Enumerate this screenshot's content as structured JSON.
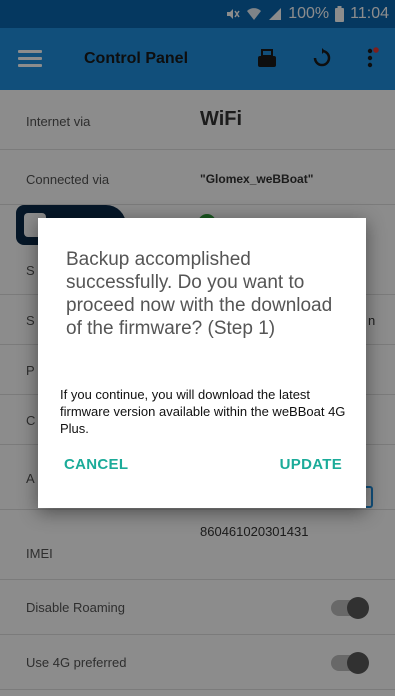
{
  "status_bar": {
    "icons": [
      "mute-icon",
      "wifi-icon",
      "signal-icon"
    ],
    "battery": "100%",
    "time": "11:04"
  },
  "toolbar": {
    "title": "Control Panel",
    "icons": [
      "menu-icon",
      "router-icon",
      "refresh-icon",
      "overflow-menu-icon"
    ]
  },
  "rows": {
    "internet_via": {
      "label": "Internet via",
      "value": "WiFi"
    },
    "connected_via": {
      "label": "Connected via",
      "value": "\"Glomex_weBBoat\""
    },
    "row3_label_letter": "S",
    "row4_label_letter": "S",
    "row4_value_suffix": "n",
    "row5_label_letter": "P",
    "row6_label_letter": "C",
    "row7_label_letter": "A",
    "imei": {
      "label": "IMEI",
      "value": "860461020301431"
    },
    "disable_roaming": {
      "label": "Disable Roaming"
    },
    "use_4g": {
      "label": "Use 4G preferred"
    }
  },
  "dialog": {
    "title": "Backup accomplished successfully. Do you want to proceed now with the download of the firmware? (Step 1)",
    "message": "If you continue, you will download the latest firmware version available within the weBBoat 4G Plus.",
    "cancel_label": "CANCEL",
    "update_label": "UPDATE"
  },
  "colors": {
    "status_bar": "#0a66b0",
    "toolbar": "#1f90e0",
    "accent": "#1bab99",
    "wifi": "#1b9e3e"
  }
}
